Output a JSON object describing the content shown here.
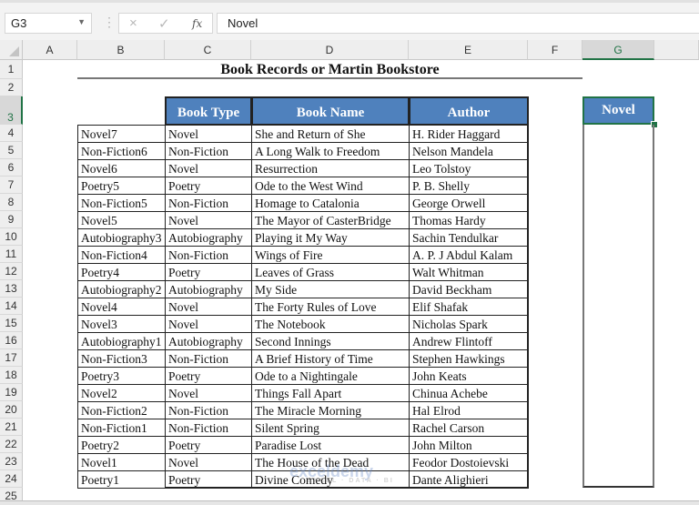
{
  "formula_bar": {
    "name_box": "G3",
    "cancel_icon": "×",
    "enter_icon": "✓",
    "fx_label": "fx",
    "formula_value": "Novel"
  },
  "columns": [
    "A",
    "B",
    "C",
    "D",
    "E",
    "F",
    "G"
  ],
  "selected_column": "G",
  "rows": [
    "1",
    "2",
    "3",
    "4",
    "5",
    "6",
    "7",
    "8",
    "9",
    "10",
    "11",
    "12",
    "13",
    "14",
    "15",
    "16",
    "17",
    "18",
    "19",
    "20",
    "21",
    "22",
    "23",
    "24",
    "25"
  ],
  "selected_row": "3",
  "sheet": {
    "title": "Book Records or Martin Bookstore",
    "headers": [
      "Book Type",
      "Book Name",
      "Author"
    ],
    "records": [
      {
        "id": "Novel7",
        "type": "Novel",
        "name": "She and Return of She",
        "author": "H. Rider Haggard"
      },
      {
        "id": "Non-Fiction6",
        "type": "Non-Fiction",
        "name": "A Long Walk to Freedom",
        "author": "Nelson Mandela"
      },
      {
        "id": "Novel6",
        "type": "Novel",
        "name": "Resurrection",
        "author": "Leo Tolstoy"
      },
      {
        "id": "Poetry5",
        "type": "Poetry",
        "name": "Ode to the West Wind",
        "author": "P. B. Shelly"
      },
      {
        "id": "Non-Fiction5",
        "type": "Non-Fiction",
        "name": "Homage to Catalonia",
        "author": "George Orwell"
      },
      {
        "id": "Novel5",
        "type": "Novel",
        "name": "The Mayor of CasterBridge",
        "author": "Thomas Hardy"
      },
      {
        "id": "Autobiography3",
        "type": "Autobiography",
        "name": "Playing it My Way",
        "author": "Sachin Tendulkar"
      },
      {
        "id": "Non-Fiction4",
        "type": "Non-Fiction",
        "name": "Wings of Fire",
        "author": "A. P. J Abdul Kalam"
      },
      {
        "id": "Poetry4",
        "type": "Poetry",
        "name": "Leaves of Grass",
        "author": "Walt Whitman"
      },
      {
        "id": "Autobiography2",
        "type": "Autobiography",
        "name": "My Side",
        "author": "David Beckham"
      },
      {
        "id": "Novel4",
        "type": "Novel",
        "name": "The Forty Rules of Love",
        "author": "Elif Shafak"
      },
      {
        "id": "Novel3",
        "type": "Novel",
        "name": "The Notebook",
        "author": "Nicholas Spark"
      },
      {
        "id": "Autobiography1",
        "type": "Autobiography",
        "name": "Second Innings",
        "author": "Andrew Flintoff"
      },
      {
        "id": "Non-Fiction3",
        "type": "Non-Fiction",
        "name": "A Brief History of Time",
        "author": "Stephen Hawkings"
      },
      {
        "id": "Poetry3",
        "type": "Poetry",
        "name": "Ode to a Nightingale",
        "author": "John Keats"
      },
      {
        "id": "Novel2",
        "type": "Novel",
        "name": "Things Fall Apart",
        "author": "Chinua Achebe"
      },
      {
        "id": "Non-Fiction2",
        "type": "Non-Fiction",
        "name": "The Miracle Morning",
        "author": "Hal Elrod"
      },
      {
        "id": "Non-Fiction1",
        "type": "Non-Fiction",
        "name": "Silent Spring",
        "author": "Rachel Carson"
      },
      {
        "id": "Poetry2",
        "type": "Poetry",
        "name": "Paradise Lost",
        "author": "John Milton"
      },
      {
        "id": "Novel1",
        "type": "Novel",
        "name": "The House of the Dead",
        "author": "Feodor Dostoievski"
      },
      {
        "id": "Poetry1",
        "type": "Poetry",
        "name": "Divine Comedy",
        "author": "Dante Alighieri"
      }
    ],
    "criteria_cell": "Novel"
  },
  "watermark": {
    "brand": "exceldemy",
    "tagline": "EXCEL · DATA · BI"
  },
  "colors": {
    "header_fill": "#4f81bd",
    "selection": "#217346"
  }
}
